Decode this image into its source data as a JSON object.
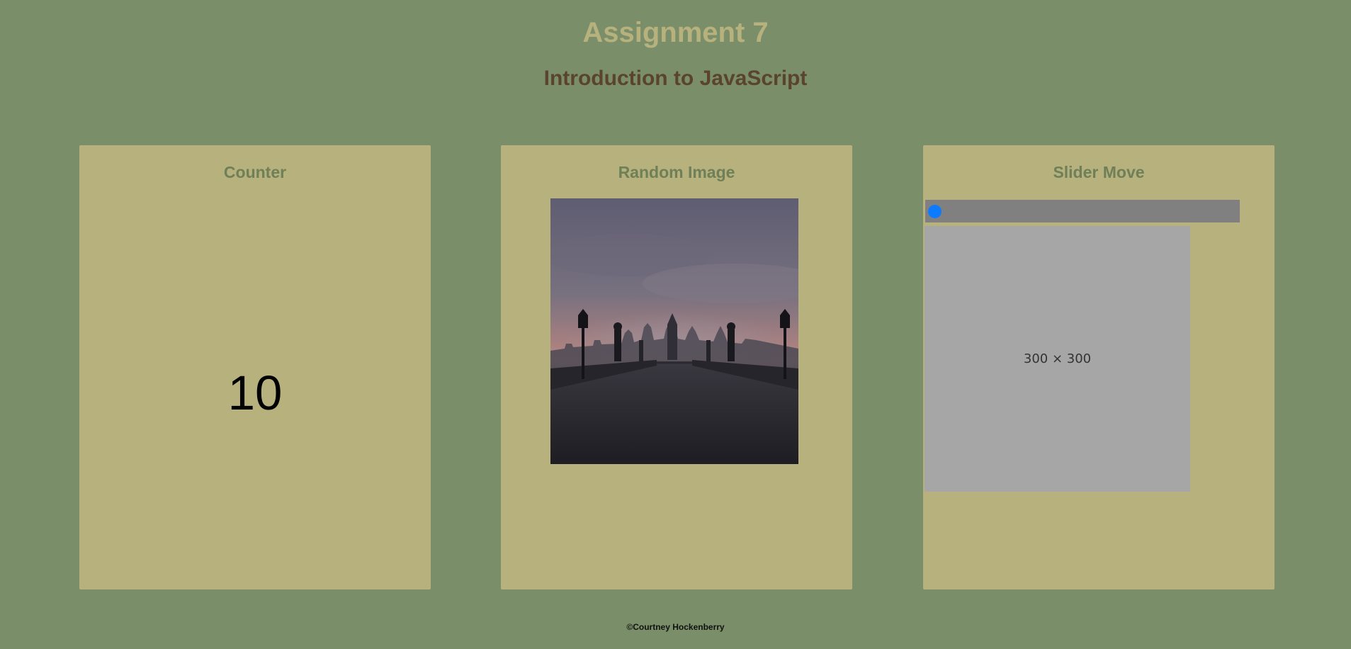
{
  "header": {
    "title": "Assignment 7",
    "subtitle": "Introduction to JavaScript"
  },
  "cards": {
    "counter": {
      "title": "Counter",
      "value": "10"
    },
    "random_image": {
      "title": "Random Image",
      "image_description": "night-bridge-photo"
    },
    "slider": {
      "title": "Slider Move",
      "position_fraction": 0,
      "placeholder_text": "300 × 300"
    }
  },
  "footer": {
    "text": "©Courtney Hockenberry"
  },
  "colors": {
    "background": "#7a8f69",
    "card": "#b6b17d",
    "title": "#b6b17d",
    "subtitle": "#5a4430",
    "card_title": "#6f7f57",
    "slider_track": "#808080",
    "slider_thumb": "#0d7bff",
    "placeholder": "#a6a6a6"
  }
}
